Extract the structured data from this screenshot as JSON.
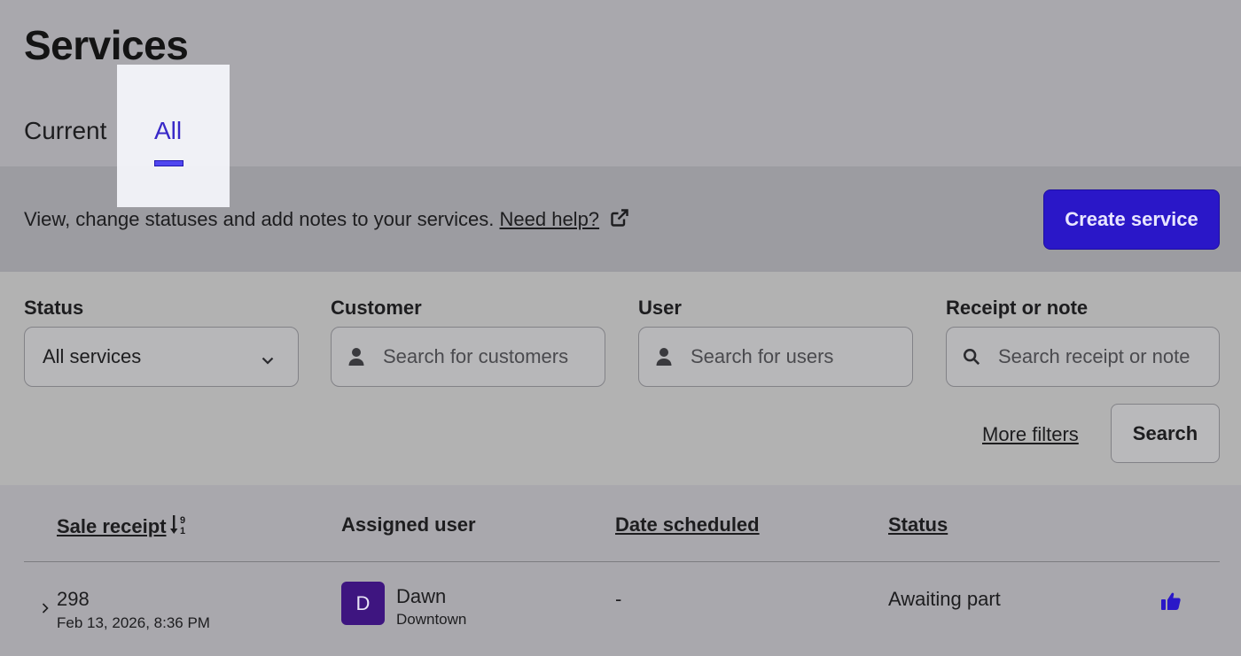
{
  "page": {
    "title": "Services"
  },
  "tabs": [
    {
      "label": "Current",
      "active": false
    },
    {
      "label": "All",
      "active": true
    }
  ],
  "info_bar": {
    "description": "View, change statuses and add notes to your services.",
    "help_link": "Need help?",
    "help_icon": "external-link-icon",
    "create_button": "Create service"
  },
  "filters": {
    "status": {
      "label": "Status",
      "value": "All services",
      "icon": "chevron-down-icon"
    },
    "customer": {
      "label": "Customer",
      "placeholder": "Search for customers",
      "icon": "person-icon"
    },
    "user": {
      "label": "User",
      "placeholder": "Search for users",
      "icon": "person-icon"
    },
    "receipt": {
      "label": "Receipt or note",
      "placeholder": "Search receipt or note",
      "icon": "search-icon"
    },
    "more_filters": "More filters",
    "search_button": "Search"
  },
  "table": {
    "columns": [
      "Sale receipt",
      "Assigned user",
      "Date scheduled",
      "Status"
    ],
    "rows": [
      {
        "receipt": "298",
        "date": "Feb 13, 2026, 8:36 PM",
        "avatar_initial": "D",
        "user_name": "Dawn",
        "user_location": "Downtown",
        "date_scheduled": "-",
        "status": "Awaiting part",
        "status_icon": "thumbs-up-icon"
      }
    ]
  },
  "colors": {
    "accent": "#2a17c8",
    "active_tab": "#3828c8",
    "avatar": "#3e1580"
  }
}
